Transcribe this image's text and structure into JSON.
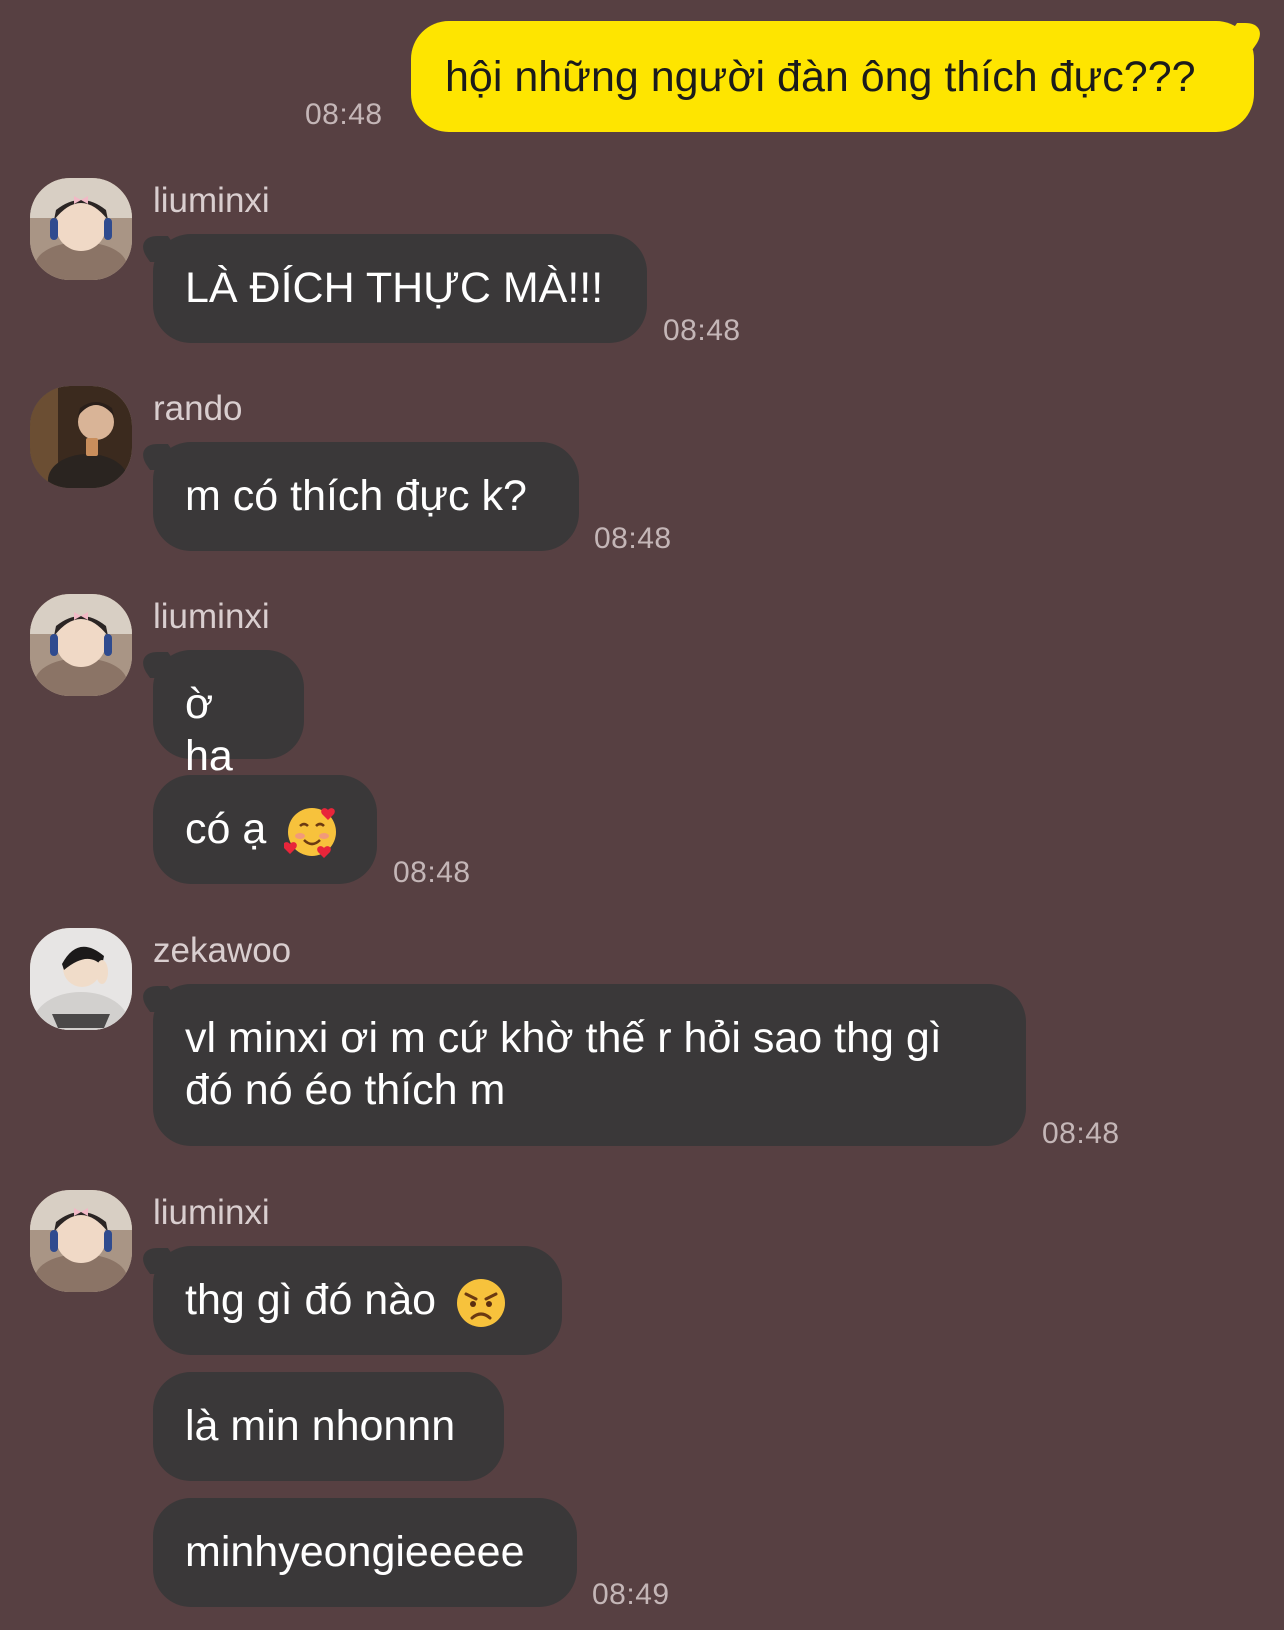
{
  "colors": {
    "background": "#574042",
    "incoming_bubble": "#3a3839",
    "outgoing_bubble": "#fee500",
    "timestamp": "#c4b6b7"
  },
  "outgoing": {
    "text": "hội những người đàn ông thích đực???",
    "time": "08:48"
  },
  "groups": [
    {
      "sender": "liuminxi",
      "avatar": "liuminxi-avatar",
      "messages": [
        "LÀ ĐÍCH THỰC MÀ!!!"
      ],
      "time": "08:48"
    },
    {
      "sender": "rando",
      "avatar": "rando-avatar",
      "messages": [
        "m có thích đực k?"
      ],
      "time": "08:48"
    },
    {
      "sender": "liuminxi",
      "avatar": "liuminxi-avatar",
      "messages": [
        "ờ ha",
        "có ạ"
      ],
      "emoji": "smiling-face-with-hearts-icon",
      "time": "08:48"
    },
    {
      "sender": "zekawoo",
      "avatar": "zekawoo-avatar",
      "messages": [
        "vl minxi ơi m cứ khờ thế r hỏi sao thg gì",
        "đó nó éo thích m"
      ],
      "time": "08:48"
    },
    {
      "sender": "liuminxi",
      "avatar": "liuminxi-avatar",
      "messages": [
        "thg gì đó nào",
        "là min nhonnn",
        "minhyeongieeeee"
      ],
      "emoji": "angry-face-icon",
      "time": "08:49"
    }
  ]
}
